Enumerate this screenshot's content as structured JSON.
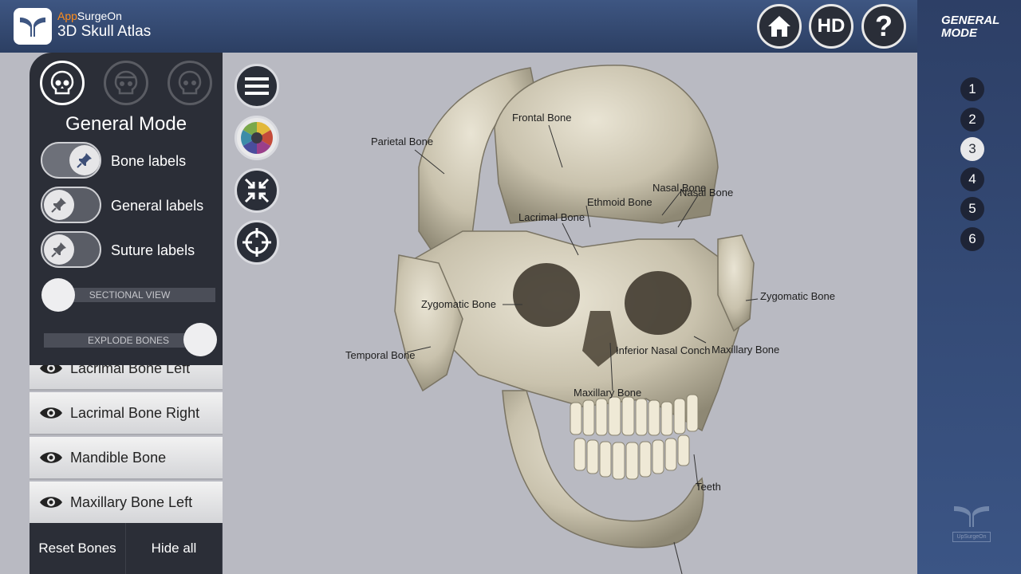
{
  "app": {
    "brand_app": "App",
    "brand_name": "SurgeOn",
    "title": "3D Skull Atlas"
  },
  "top_buttons": {
    "home": "home-icon",
    "hd_label": "HD",
    "help_label": "?"
  },
  "right_sidebar": {
    "mode_line1": "GENERAL",
    "mode_line2": "MODE",
    "steps": [
      "1",
      "2",
      "3",
      "4",
      "5",
      "6"
    ],
    "active_step": "3",
    "watermark": "UpSurgeOn"
  },
  "left_panel": {
    "mode_title": "General Mode",
    "toggles": {
      "bone_labels": "Bone labels",
      "general_labels": "General labels",
      "suture_labels": "Suture labels"
    },
    "sectional_view": "SECTIONAL VIEW",
    "explode_bones": "EXPLODE BONES"
  },
  "bone_list": [
    "Lacrimal Bone Left",
    "Lacrimal Bone Right",
    "Mandible Bone",
    "Maxillary Bone Left"
  ],
  "bottom_buttons": {
    "reset": "Reset Bones",
    "hide": "Hide all"
  },
  "skull_labels": {
    "frontal": "Frontal Bone",
    "parietal": "Parietal Bone",
    "nasal1": "Nasal Bone",
    "nasal2": "Nasal Bone",
    "ethmoid": "Ethmoid Bone",
    "lacrimal": "Lacrimal Bone",
    "zygomatic_left": "Zygomatic Bone",
    "zygomatic_right": "Zygomatic Bone",
    "temporal": "Temporal Bone",
    "inferior_nasal": "Inferior Nasal Conch",
    "maxillary_right": "Maxillary Bone",
    "maxillary_center": "Maxillary Bone",
    "teeth": "Teeth"
  },
  "colors": {
    "accent": "#ff8c1a",
    "bar": "#2c3f63",
    "panel": "#2b2e37",
    "viewport": "#b9bac2"
  }
}
